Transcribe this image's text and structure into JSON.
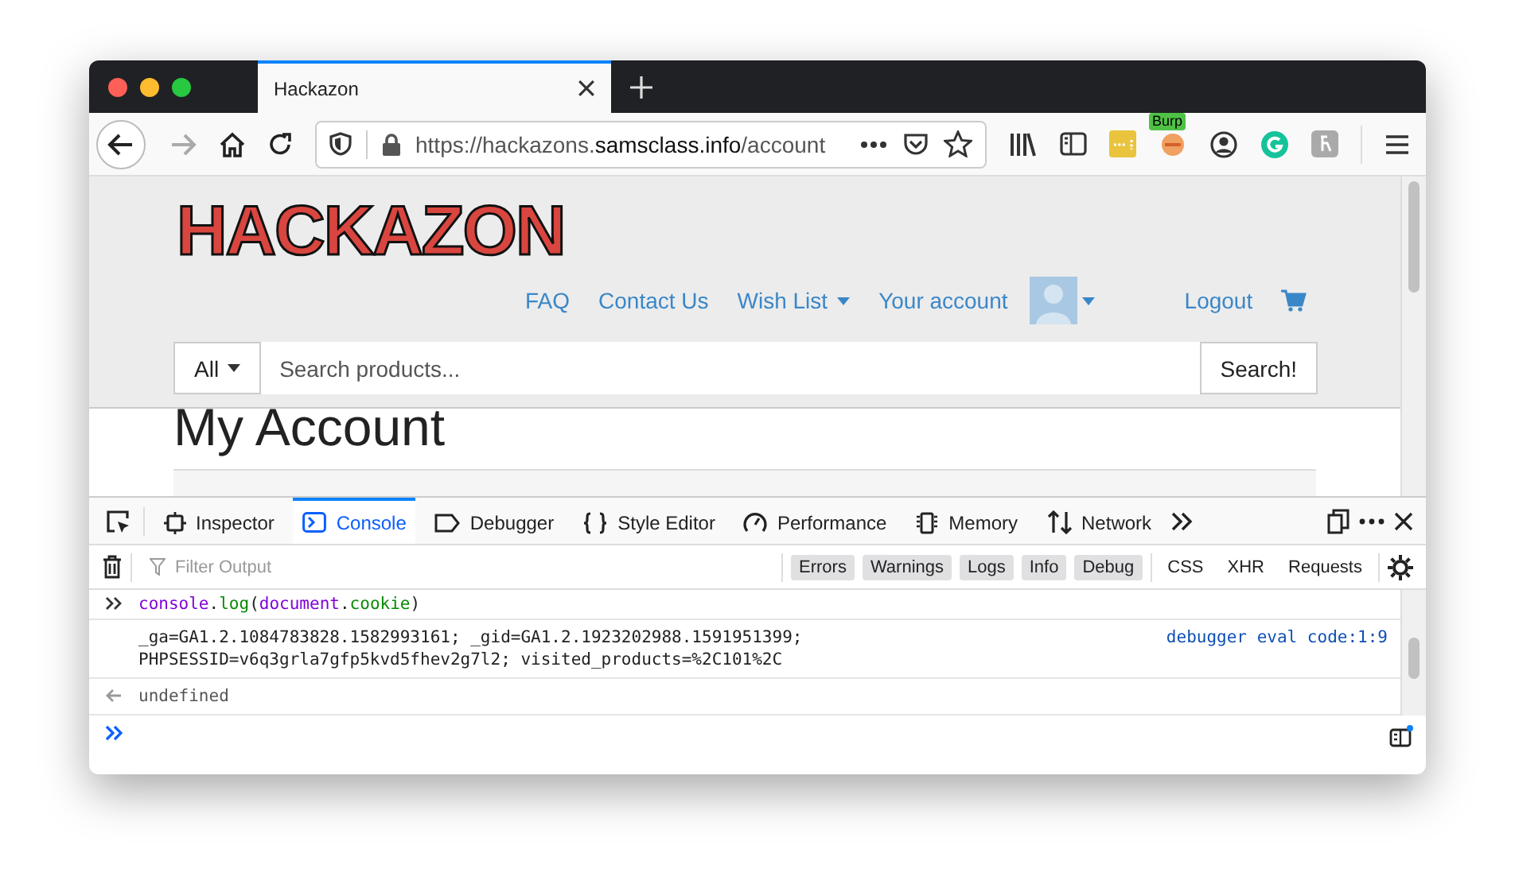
{
  "browser_tab": {
    "title": "Hackazon"
  },
  "address_bar": {
    "url": [
      "https://hackazons.",
      "samsclass.info",
      "/account"
    ]
  },
  "extension_badge": "Burp",
  "site": {
    "logo": "HACKAZON",
    "nav": [
      {
        "label": "FAQ",
        "dropdown": false
      },
      {
        "label": "Contact Us",
        "dropdown": false
      },
      {
        "label": "Wish List",
        "dropdown": true
      },
      {
        "label": "Your account",
        "dropdown": false
      }
    ],
    "logout": "Logout",
    "search": {
      "category": "All",
      "placeholder": "Search products...",
      "button": "Search!"
    },
    "heading": "My Account"
  },
  "devtools": {
    "tabs": [
      {
        "label": "Inspector",
        "selected": false
      },
      {
        "label": "Console",
        "selected": true
      },
      {
        "label": "Debugger",
        "selected": false
      },
      {
        "label": "Style Editor",
        "selected": false
      },
      {
        "label": "Performance",
        "selected": false
      },
      {
        "label": "Memory",
        "selected": false
      },
      {
        "label": "Network",
        "selected": false
      }
    ],
    "filter_placeholder": "Filter Output",
    "levels": [
      {
        "label": "Errors",
        "selected": true
      },
      {
        "label": "Warnings",
        "selected": true
      },
      {
        "label": "Logs",
        "selected": true
      },
      {
        "label": "Info",
        "selected": true
      },
      {
        "label": "Debug",
        "selected": true
      }
    ],
    "types": [
      {
        "label": "CSS",
        "selected": false
      },
      {
        "label": "XHR",
        "selected": false
      },
      {
        "label": "Requests",
        "selected": false
      }
    ],
    "input": [
      {
        "text": "console",
        "kind": "object"
      },
      {
        "text": ".",
        "kind": "punct"
      },
      {
        "text": "log",
        "kind": "property"
      },
      {
        "text": "(",
        "kind": "punct"
      },
      {
        "text": "document",
        "kind": "object"
      },
      {
        "text": ".",
        "kind": "punct"
      },
      {
        "text": "cookie",
        "kind": "property"
      },
      {
        "text": ")",
        "kind": "punct"
      }
    ],
    "output": [
      "_ga=GA1.2.1084783828.1582993161; _gid=GA1.2.1923202988.1591951399;",
      "PHPSESSID=v6q3grla7gfp5kvd5fhev2g7l2; visited_products=%2C101%2C"
    ],
    "source": "debugger eval code:1:9",
    "result": "undefined"
  }
}
